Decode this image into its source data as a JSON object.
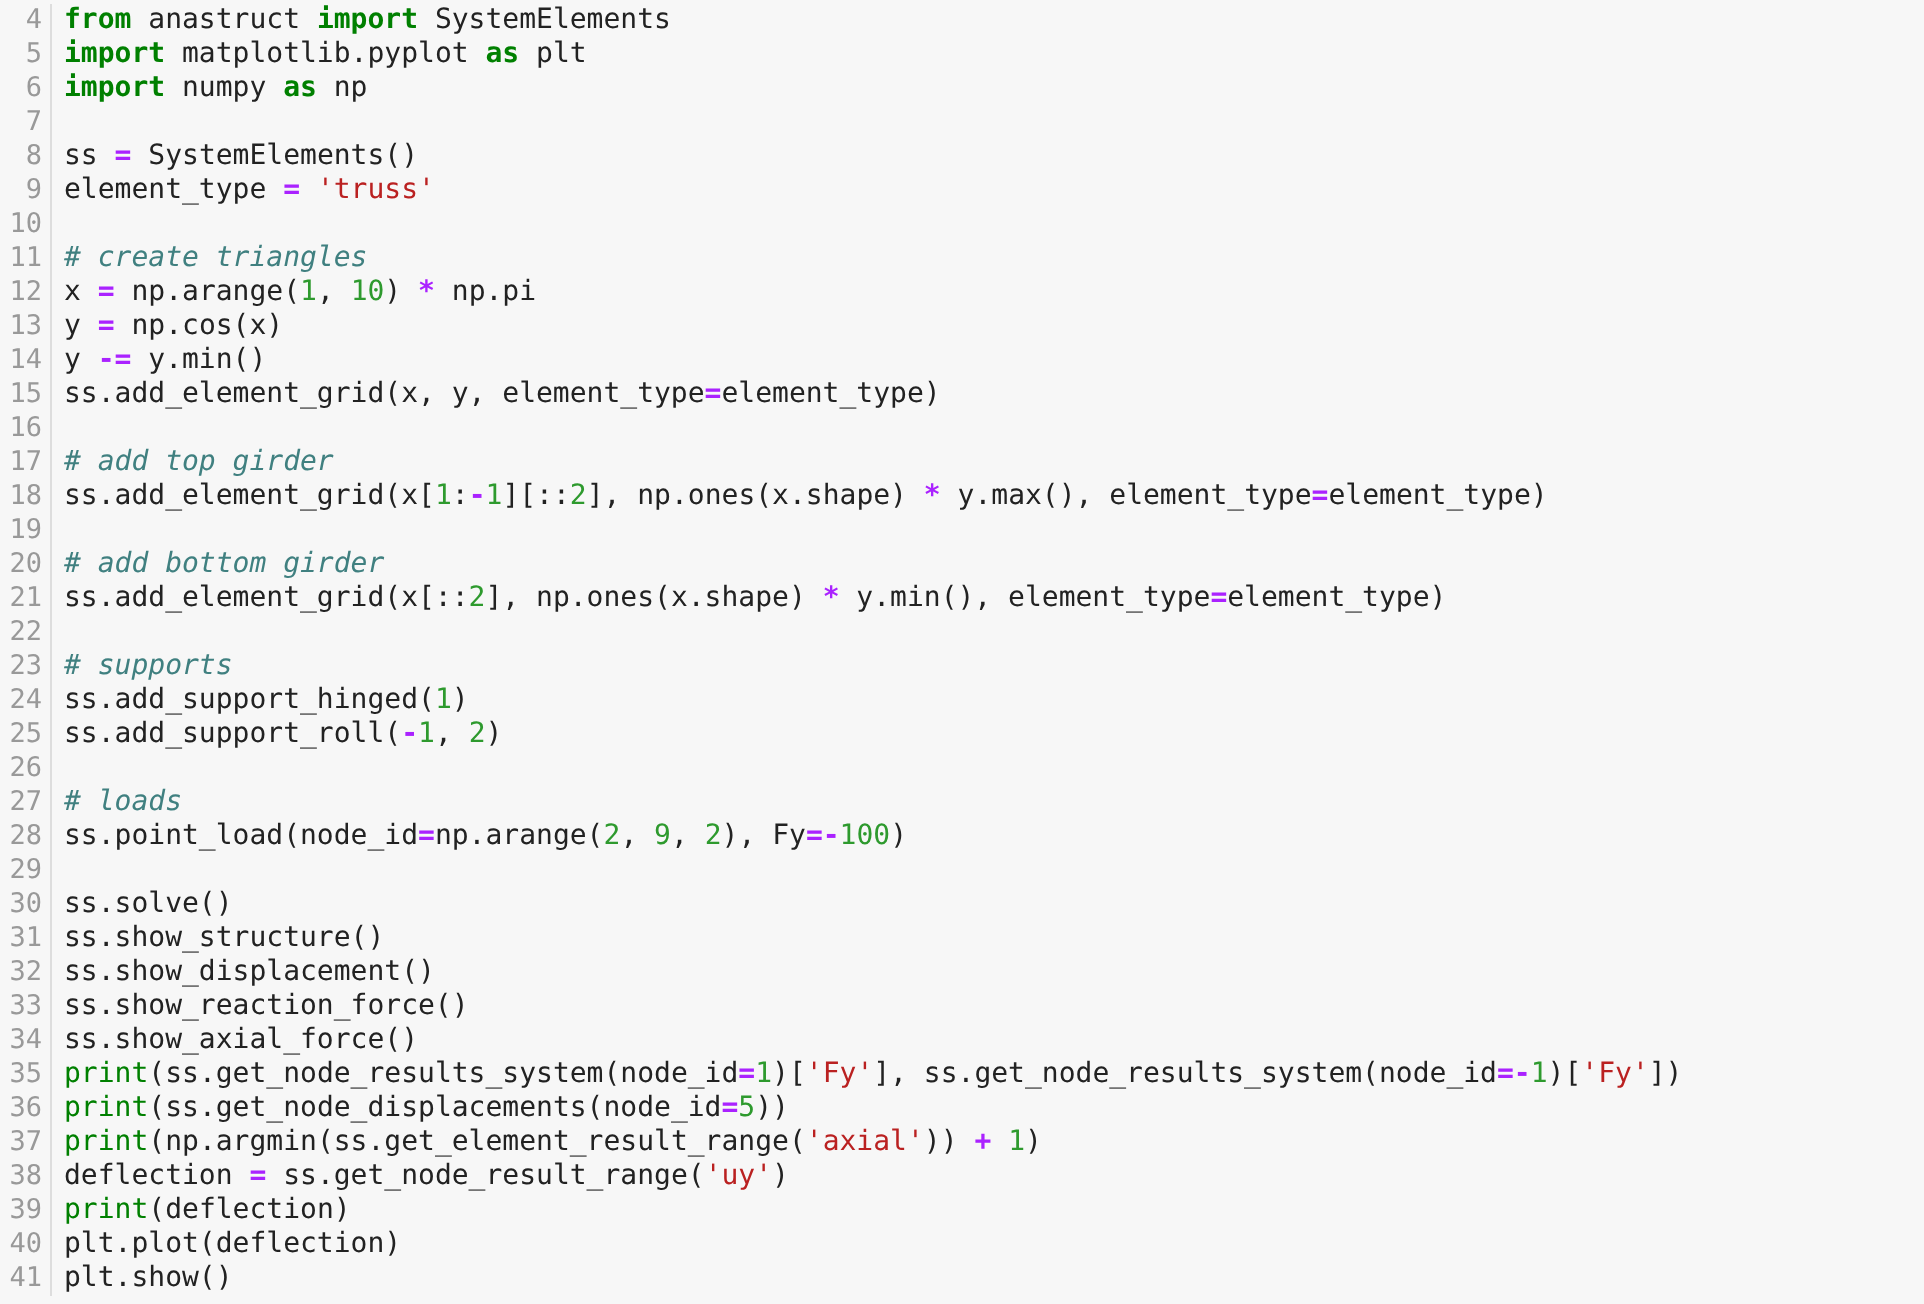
{
  "editor": {
    "lines": [
      {
        "number": "4",
        "tokens": [
          {
            "kind": "keyword",
            "text": "from"
          },
          {
            "kind": "plain",
            "text": " anastruct "
          },
          {
            "kind": "keyword",
            "text": "import"
          },
          {
            "kind": "plain",
            "text": " SystemElements"
          }
        ]
      },
      {
        "number": "5",
        "tokens": [
          {
            "kind": "keyword",
            "text": "import"
          },
          {
            "kind": "plain",
            "text": " matplotlib.pyplot "
          },
          {
            "kind": "keyword",
            "text": "as"
          },
          {
            "kind": "plain",
            "text": " plt"
          }
        ]
      },
      {
        "number": "6",
        "tokens": [
          {
            "kind": "keyword",
            "text": "import"
          },
          {
            "kind": "plain",
            "text": " numpy "
          },
          {
            "kind": "keyword",
            "text": "as"
          },
          {
            "kind": "plain",
            "text": " np"
          }
        ]
      },
      {
        "number": "7"
      },
      {
        "number": "8",
        "tokens": [
          {
            "kind": "plain",
            "text": "ss "
          },
          {
            "kind": "operator",
            "text": "="
          },
          {
            "kind": "plain",
            "text": " SystemElements()"
          }
        ]
      },
      {
        "number": "9",
        "tokens": [
          {
            "kind": "plain",
            "text": "element_type "
          },
          {
            "kind": "operator",
            "text": "= "
          },
          {
            "kind": "string",
            "text": "'truss'"
          }
        ]
      },
      {
        "number": "10"
      },
      {
        "number": "11",
        "tokens": [
          {
            "kind": "comment",
            "text": "# create triangles"
          }
        ]
      },
      {
        "number": "12",
        "tokens": [
          {
            "kind": "plain",
            "text": "x "
          },
          {
            "kind": "operator",
            "text": "="
          },
          {
            "kind": "plain",
            "text": " np.arange("
          },
          {
            "kind": "number",
            "text": "1"
          },
          {
            "kind": "plain",
            "text": ", "
          },
          {
            "kind": "number",
            "text": "10"
          },
          {
            "kind": "plain",
            "text": ") "
          },
          {
            "kind": "operator",
            "text": "*"
          },
          {
            "kind": "plain",
            "text": " np.pi"
          }
        ]
      },
      {
        "number": "13",
        "tokens": [
          {
            "kind": "plain",
            "text": "y "
          },
          {
            "kind": "operator",
            "text": "="
          },
          {
            "kind": "plain",
            "text": " np.cos(x)"
          }
        ]
      },
      {
        "number": "14",
        "tokens": [
          {
            "kind": "plain",
            "text": "y "
          },
          {
            "kind": "operator",
            "text": "-="
          },
          {
            "kind": "plain",
            "text": " y.min()"
          }
        ]
      },
      {
        "number": "15",
        "tokens": [
          {
            "kind": "plain",
            "text": "ss.add_element_grid(x, y, element_type"
          },
          {
            "kind": "operator",
            "text": "="
          },
          {
            "kind": "plain",
            "text": "element_type)"
          }
        ]
      },
      {
        "number": "16"
      },
      {
        "number": "17",
        "tokens": [
          {
            "kind": "comment",
            "text": "# add top girder"
          }
        ]
      },
      {
        "number": "18",
        "tokens": [
          {
            "kind": "plain",
            "text": "ss.add_element_grid(x["
          },
          {
            "kind": "number",
            "text": "1"
          },
          {
            "kind": "plain",
            "text": ":"
          },
          {
            "kind": "operator",
            "text": "-"
          },
          {
            "kind": "number",
            "text": "1"
          },
          {
            "kind": "plain",
            "text": "][::"
          },
          {
            "kind": "number",
            "text": "2"
          },
          {
            "kind": "plain",
            "text": "], np.ones(x.shape) "
          },
          {
            "kind": "operator",
            "text": "*"
          },
          {
            "kind": "plain",
            "text": " y.max(), element_type"
          },
          {
            "kind": "operator",
            "text": "="
          },
          {
            "kind": "plain",
            "text": "element_type)"
          }
        ]
      },
      {
        "number": "19"
      },
      {
        "number": "20",
        "tokens": [
          {
            "kind": "comment",
            "text": "# add bottom girder"
          }
        ]
      },
      {
        "number": "21",
        "tokens": [
          {
            "kind": "plain",
            "text": "ss.add_element_grid(x[::"
          },
          {
            "kind": "number",
            "text": "2"
          },
          {
            "kind": "plain",
            "text": "], np.ones(x.shape) "
          },
          {
            "kind": "operator",
            "text": "*"
          },
          {
            "kind": "plain",
            "text": " y.min(), element_type"
          },
          {
            "kind": "operator",
            "text": "="
          },
          {
            "kind": "plain",
            "text": "element_type)"
          }
        ]
      },
      {
        "number": "22"
      },
      {
        "number": "23",
        "tokens": [
          {
            "kind": "comment",
            "text": "# supports"
          }
        ]
      },
      {
        "number": "24",
        "tokens": [
          {
            "kind": "plain",
            "text": "ss.add_support_hinged("
          },
          {
            "kind": "number",
            "text": "1"
          },
          {
            "kind": "plain",
            "text": ")"
          }
        ]
      },
      {
        "number": "25",
        "tokens": [
          {
            "kind": "plain",
            "text": "ss.add_support_roll("
          },
          {
            "kind": "operator",
            "text": "-"
          },
          {
            "kind": "number",
            "text": "1"
          },
          {
            "kind": "plain",
            "text": ", "
          },
          {
            "kind": "number",
            "text": "2"
          },
          {
            "kind": "plain",
            "text": ")"
          }
        ]
      },
      {
        "number": "26"
      },
      {
        "number": "27",
        "tokens": [
          {
            "kind": "comment",
            "text": "# loads"
          }
        ]
      },
      {
        "number": "28",
        "tokens": [
          {
            "kind": "plain",
            "text": "ss.point_load(node_id"
          },
          {
            "kind": "operator",
            "text": "="
          },
          {
            "kind": "plain",
            "text": "np.arange("
          },
          {
            "kind": "number",
            "text": "2"
          },
          {
            "kind": "plain",
            "text": ", "
          },
          {
            "kind": "number",
            "text": "9"
          },
          {
            "kind": "plain",
            "text": ", "
          },
          {
            "kind": "number",
            "text": "2"
          },
          {
            "kind": "plain",
            "text": "), Fy"
          },
          {
            "kind": "operator",
            "text": "=-"
          },
          {
            "kind": "number",
            "text": "100"
          },
          {
            "kind": "plain",
            "text": ")"
          }
        ]
      },
      {
        "number": "29"
      },
      {
        "number": "30",
        "tokens": [
          {
            "kind": "plain",
            "text": "ss.solve()"
          }
        ]
      },
      {
        "number": "31",
        "tokens": [
          {
            "kind": "plain",
            "text": "ss.show_structure()"
          }
        ]
      },
      {
        "number": "32",
        "tokens": [
          {
            "kind": "plain",
            "text": "ss.show_displacement()"
          }
        ]
      },
      {
        "number": "33",
        "tokens": [
          {
            "kind": "plain",
            "text": "ss.show_reaction_force()"
          }
        ]
      },
      {
        "number": "34",
        "tokens": [
          {
            "kind": "plain",
            "text": "ss.show_axial_force()"
          }
        ]
      },
      {
        "number": "35",
        "tokens": [
          {
            "kind": "builtin",
            "text": "print"
          },
          {
            "kind": "plain",
            "text": "(ss.get_node_results_system(node_id"
          },
          {
            "kind": "operator",
            "text": "="
          },
          {
            "kind": "number",
            "text": "1"
          },
          {
            "kind": "plain",
            "text": ")["
          },
          {
            "kind": "string",
            "text": "'Fy'"
          },
          {
            "kind": "plain",
            "text": "], ss.get_node_results_system(node_id"
          },
          {
            "kind": "operator",
            "text": "=-"
          },
          {
            "kind": "number",
            "text": "1"
          },
          {
            "kind": "plain",
            "text": ")["
          },
          {
            "kind": "string",
            "text": "'Fy'"
          },
          {
            "kind": "plain",
            "text": "])"
          }
        ]
      },
      {
        "number": "36",
        "tokens": [
          {
            "kind": "builtin",
            "text": "print"
          },
          {
            "kind": "plain",
            "text": "(ss.get_node_displacements(node_id"
          },
          {
            "kind": "operator",
            "text": "="
          },
          {
            "kind": "number",
            "text": "5"
          },
          {
            "kind": "plain",
            "text": "))"
          }
        ]
      },
      {
        "number": "37",
        "tokens": [
          {
            "kind": "builtin",
            "text": "print"
          },
          {
            "kind": "plain",
            "text": "(np.argmin(ss.get_element_result_range("
          },
          {
            "kind": "string",
            "text": "'axial'"
          },
          {
            "kind": "plain",
            "text": ")) "
          },
          {
            "kind": "operator",
            "text": "+ "
          },
          {
            "kind": "number",
            "text": "1"
          },
          {
            "kind": "plain",
            "text": ")"
          }
        ]
      },
      {
        "number": "38",
        "tokens": [
          {
            "kind": "plain",
            "text": "deflection "
          },
          {
            "kind": "operator",
            "text": "="
          },
          {
            "kind": "plain",
            "text": " ss.get_node_result_range("
          },
          {
            "kind": "string",
            "text": "'uy'"
          },
          {
            "kind": "plain",
            "text": ")"
          }
        ]
      },
      {
        "number": "39",
        "tokens": [
          {
            "kind": "builtin",
            "text": "print"
          },
          {
            "kind": "plain",
            "text": "(deflection)"
          }
        ]
      },
      {
        "number": "40",
        "tokens": [
          {
            "kind": "plain",
            "text": "plt.plot(deflection)"
          }
        ]
      },
      {
        "number": "41",
        "tokens": [
          {
            "kind": "plain",
            "text": "plt.show()"
          }
        ]
      }
    ]
  }
}
